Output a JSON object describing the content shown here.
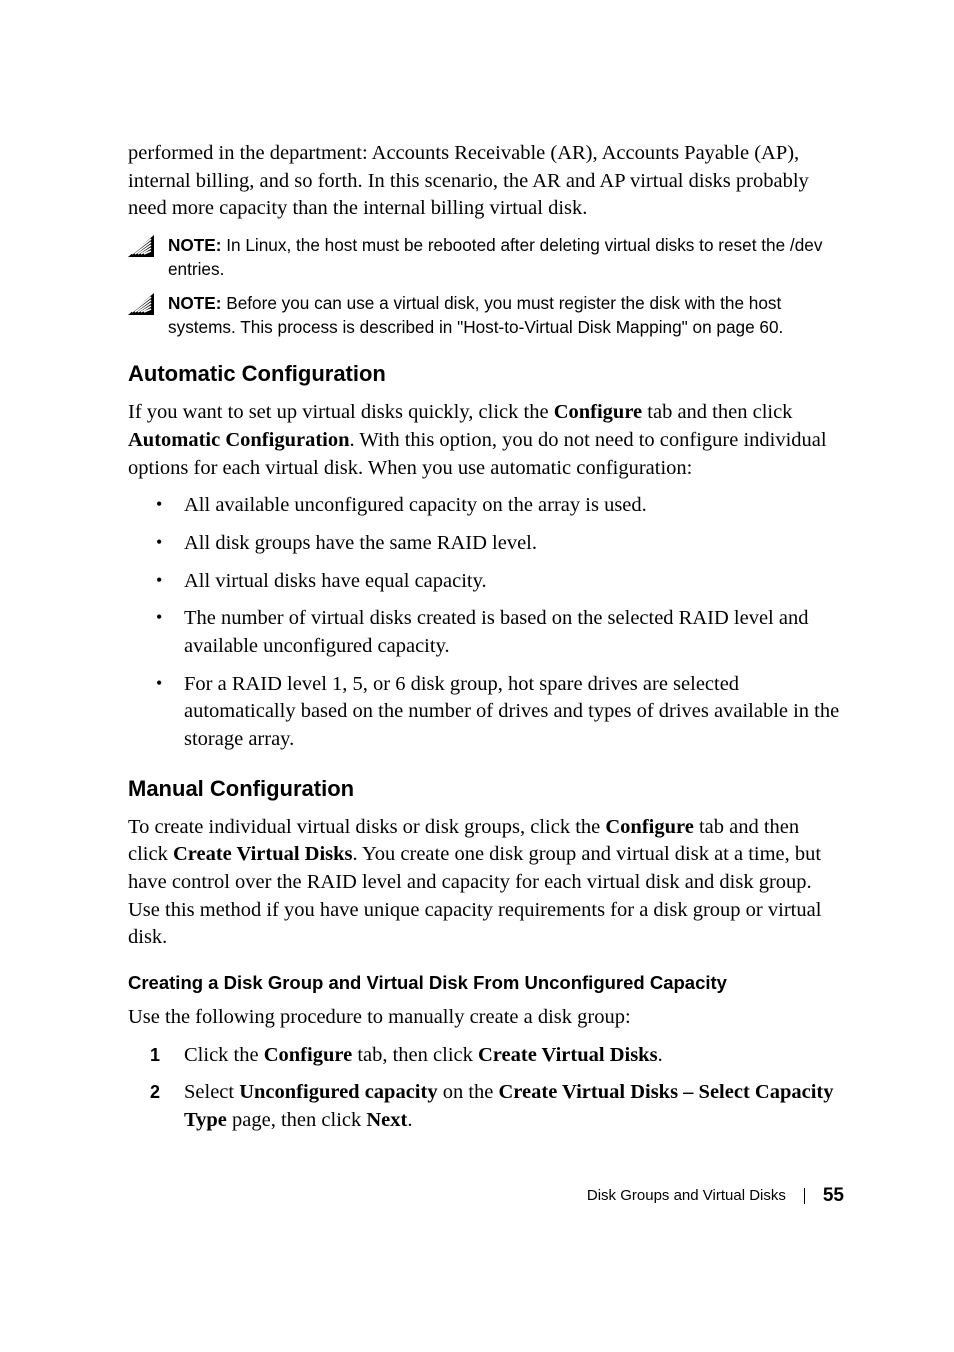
{
  "intro": "performed in the department: Accounts Receivable (AR), Accounts Payable (AP), internal billing, and so forth. In this scenario, the AR and AP virtual disks probably need more capacity than the internal billing virtual disk.",
  "notes": [
    {
      "label": "NOTE:",
      "text": " In Linux, the host must be rebooted after deleting virtual disks to reset the /dev entries."
    },
    {
      "label": "NOTE:",
      "text": " Before you can use a virtual disk, you must register the disk with the host systems. This process is described in \"Host-to-Virtual Disk Mapping\" on page 60."
    }
  ],
  "auto": {
    "heading": "Automatic Configuration",
    "para_pre": "If you want to set up virtual disks quickly, click the ",
    "para_b1": "Configure",
    "para_mid1": " tab and then click ",
    "para_b2": "Automatic Configuration",
    "para_post": ". With this option, you do not need to configure individual options for each virtual disk. When you use automatic configuration:",
    "bullets": [
      "All available unconfigured capacity on the array is used.",
      "All disk groups have the same RAID level.",
      "All virtual disks have equal capacity.",
      "The number of virtual disks created is based on the selected RAID level and available unconfigured capacity.",
      "For a RAID level 1, 5, or 6 disk group, hot spare drives are selected automatically based on the number of drives and types of drives available in the storage array."
    ]
  },
  "manual": {
    "heading": "Manual Configuration",
    "para_pre": "To create individual virtual disks or disk groups, click the ",
    "para_b1": "Configure",
    "para_mid1": " tab and then click ",
    "para_b2": "Create Virtual Disks",
    "para_post": ". You create one disk group and virtual disk at a time, but have control over the RAID level and capacity for each virtual disk and disk group. Use this method if you have unique capacity requirements for a disk group or virtual disk."
  },
  "creating": {
    "heading": "Creating a Disk Group and Virtual Disk From Unconfigured Capacity",
    "para": "Use the following procedure to manually create a disk group:",
    "step1_pre": "Click the ",
    "step1_b1": "Configure",
    "step1_mid": " tab, then click ",
    "step1_b2": "Create Virtual Disks",
    "step1_post": ".",
    "step2_pre": "Select ",
    "step2_b1": "Unconfigured capacity",
    "step2_mid1": " on the ",
    "step2_b2": "Create Virtual Disks – Select Capacity Type",
    "step2_mid2": " page, then click ",
    "step2_b3": "Next",
    "step2_post": "."
  },
  "footer": {
    "section": "Disk Groups and Virtual Disks",
    "page": "55"
  }
}
